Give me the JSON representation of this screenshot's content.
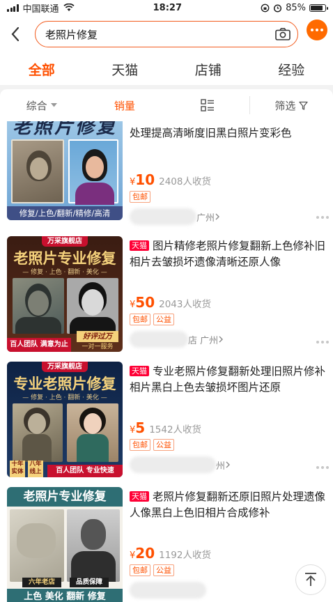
{
  "status_bar": {
    "carrier": "中国联通",
    "time": "18:27",
    "battery": "85%",
    "battery_level": 0.85
  },
  "search": {
    "query": "老照片修复"
  },
  "tabs": [
    {
      "label": "全部",
      "active": true
    },
    {
      "label": "天猫",
      "active": false
    },
    {
      "label": "店铺",
      "active": false
    },
    {
      "label": "经验",
      "active": false
    }
  ],
  "filters": {
    "sort": "综合",
    "sales": "销量",
    "filter": "筛选"
  },
  "colors": {
    "accent": "#ff5000",
    "tmall": "#ff0036"
  },
  "items": [
    {
      "title": "处理提高清晰度旧黑白照片变彩色",
      "price": "10",
      "currency": "¥",
      "sold": "2408人收货",
      "tags": [
        "包邮"
      ],
      "shop_suffix": "广州",
      "thumb": {
        "banner": "老照片修复",
        "footer": "修复/上色/翻新/精修/高清"
      }
    },
    {
      "badge": "天猫",
      "title": "图片精修老照片修复翻新上色修补旧相片去皱损坏遗像清晰还原人像",
      "price": "50",
      "currency": "¥",
      "sold": "2043人收货",
      "tags": [
        "包邮",
        "公益"
      ],
      "shop_suffix": "店 广州",
      "thumb": {
        "store": "万采旗舰店",
        "banner": "老照片专业修复",
        "sub": "— 修复 · 上色 · 翻新 · 美化 —",
        "footer_left": "百人团队 满意为止",
        "footer_right_top": "好评过万",
        "footer_right_bottom": "一对一服务"
      }
    },
    {
      "badge": "天猫",
      "title": "专业老照片修复翻新处理旧照片修补相片黑白上色去皱损坏图片还原",
      "price": "5",
      "currency": "¥",
      "sold": "1542人收货",
      "tags": [
        "包邮",
        "公益"
      ],
      "shop_suffix": "州",
      "thumb": {
        "store": "万采旗舰店",
        "banner": "专业老照片修复",
        "sub": "— 修复 · 上色 · 翻新 · 美化 —",
        "footer_a": "十年实体",
        "footer_b": "八年线上",
        "footer_right": "百人团队 专业快速"
      }
    },
    {
      "badge": "天猫",
      "title": "老照片修复翻新还原旧照片处理遗像人像黑白上色旧相片合成修补",
      "price": "20",
      "currency": "¥",
      "sold": "1192人收货",
      "tags": [
        "包邮",
        "公益"
      ],
      "thumb": {
        "banner": "老照片专业修复",
        "footer_a": "六年老店",
        "footer_b": "品质保障",
        "footer_items": "上色  美化  翻新  修复"
      }
    }
  ]
}
